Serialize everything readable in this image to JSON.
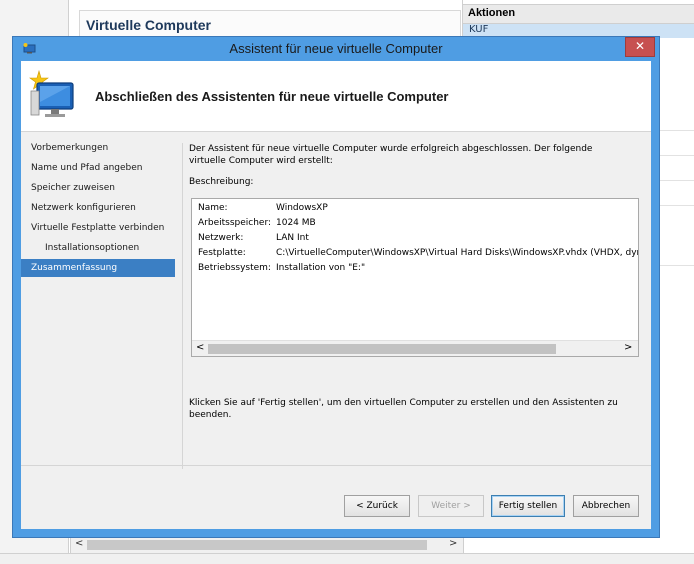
{
  "background": {
    "center_title": "Virtuelle Computer",
    "actions_title": "Aktionen",
    "actions_selected": "KUF"
  },
  "dialog": {
    "title": "Assistent für neue virtuelle Computer",
    "close_label": "✕",
    "header_title": "Abschließen des Assistenten für neue virtuelle Computer"
  },
  "steps": [
    {
      "label": "Vorbemerkungen",
      "active": false,
      "indent": false
    },
    {
      "label": "Name und Pfad angeben",
      "active": false,
      "indent": false
    },
    {
      "label": "Speicher zuweisen",
      "active": false,
      "indent": false
    },
    {
      "label": "Netzwerk konfigurieren",
      "active": false,
      "indent": false
    },
    {
      "label": "Virtuelle Festplatte verbinden",
      "active": false,
      "indent": false
    },
    {
      "label": "Installationsoptionen",
      "active": false,
      "indent": true
    },
    {
      "label": "Zusammenfassung",
      "active": true,
      "indent": false
    }
  ],
  "content": {
    "intro": "Der Assistent für neue virtuelle Computer wurde erfolgreich abgeschlossen. Der folgende virtuelle Computer wird erstellt:",
    "desc_label": "Beschreibung:",
    "rows": [
      {
        "key": "Name:",
        "value": "WindowsXP"
      },
      {
        "key": "Arbeitsspeicher:",
        "value": "1024 MB"
      },
      {
        "key": "Netzwerk:",
        "value": "LAN Int"
      },
      {
        "key": "Festplatte:",
        "value": "C:\\VirtuelleComputer\\WindowsXP\\Virtual Hard Disks\\WindowsXP.vhdx (VHDX, dynar"
      },
      {
        "key": "Betriebssystem:",
        "value": "Installation von \"E:\""
      }
    ],
    "finish_note": "Klicken Sie auf 'Fertig stellen', um den virtuellen Computer zu erstellen und den Assistenten zu beenden."
  },
  "buttons": {
    "back": "< Zurück",
    "next": "Weiter >",
    "finish": "Fertig stellen",
    "cancel": "Abbrechen"
  },
  "colors": {
    "title_bar": "#4f9de3",
    "active_step": "#3b7fc4",
    "close": "#c75050"
  }
}
